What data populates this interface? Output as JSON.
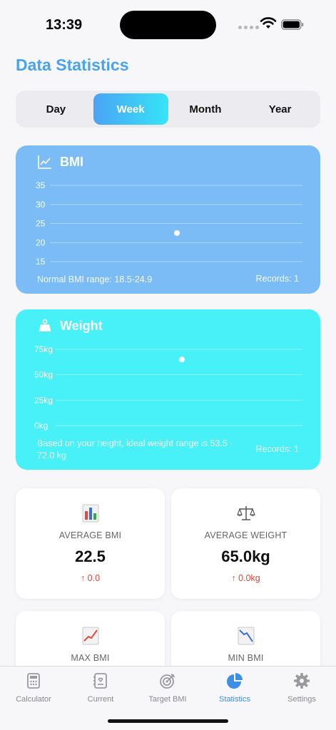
{
  "status_bar": {
    "time": "13:39"
  },
  "page_title": "Data Statistics",
  "periods": [
    "Day",
    "Week",
    "Month",
    "Year"
  ],
  "active_period": "Week",
  "bmi_card": {
    "title": "BMI",
    "range_note": "Normal BMI range: 18.5-24.9",
    "records": "Records: 1"
  },
  "weight_card": {
    "title": "Weight",
    "range_note": "Based on your height, ideal weight range is 53.5 - 72.0 kg",
    "records": "Records: 1"
  },
  "chart_data": [
    {
      "type": "scatter",
      "title": "BMI",
      "y_ticks": [
        "35",
        "30",
        "25",
        "20",
        "15"
      ],
      "ylim": [
        15,
        35
      ],
      "points": [
        22.5
      ],
      "grid": true
    },
    {
      "type": "scatter",
      "title": "Weight",
      "y_ticks": [
        "75kg",
        "50kg",
        "25kg",
        "0kg"
      ],
      "ylim": [
        0,
        75
      ],
      "points": [
        65.0
      ],
      "grid": true
    }
  ],
  "stats": [
    {
      "label": "AVERAGE BMI",
      "value": "22.5",
      "delta": "↑ 0.0",
      "icon": "bar-chart-icon"
    },
    {
      "label": "AVERAGE WEIGHT",
      "value": "65.0kg",
      "delta": "↑ 0.0kg",
      "icon": "scales-icon"
    },
    {
      "label": "MAX BMI",
      "icon": "chart-increasing-icon"
    },
    {
      "label": "MIN BMI",
      "icon": "chart-decreasing-icon"
    }
  ],
  "tabs": [
    {
      "label": "Calculator",
      "icon": "calculator-icon"
    },
    {
      "label": "Current",
      "icon": "contact-card-icon"
    },
    {
      "label": "Target BMI",
      "icon": "target-icon"
    },
    {
      "label": "Statistics",
      "icon": "pie-chart-icon"
    },
    {
      "label": "Settings",
      "icon": "gear-icon"
    }
  ],
  "active_tab": "Statistics",
  "colors": {
    "accent": "#4aa3ea",
    "bmi_card": "#7bbcf7",
    "weight_card": "#48f1f7",
    "delta": "#e0433a"
  }
}
